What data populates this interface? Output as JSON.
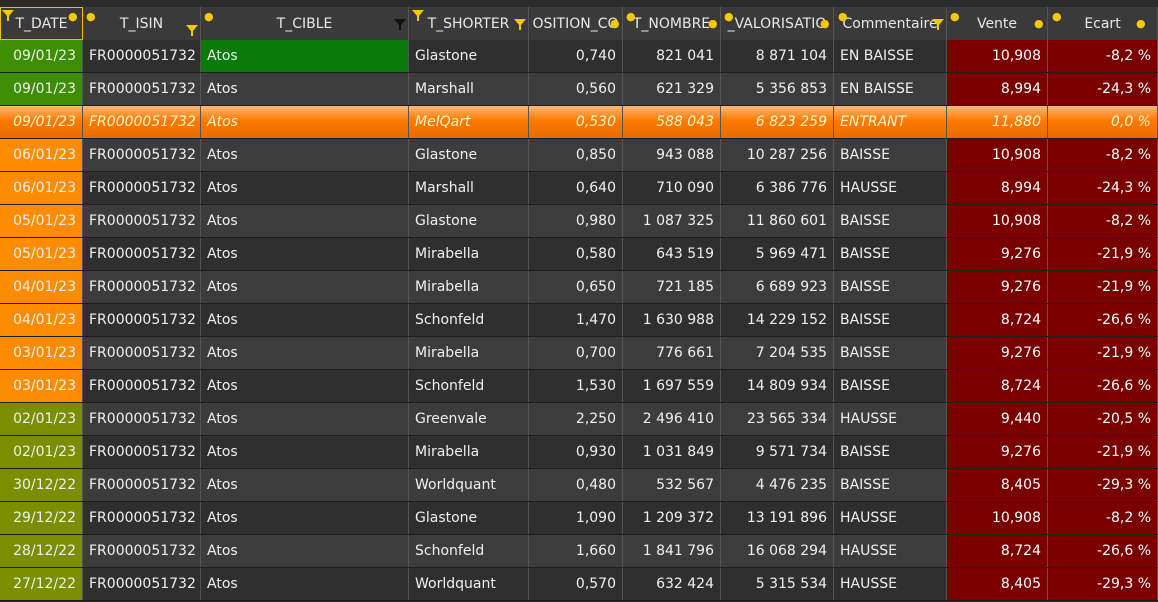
{
  "headers": [
    {
      "label": "T_DATE"
    },
    {
      "label": "T_ISIN"
    },
    {
      "label": "T_CIBLE"
    },
    {
      "label": "T_SHORTER"
    },
    {
      "label": "OSITION_CO"
    },
    {
      "label": "T_NOMBRE"
    },
    {
      "label": "_VALORISATIO"
    },
    {
      "label": "Commentaire"
    },
    {
      "label": "Vente"
    },
    {
      "label": "Ecart"
    }
  ],
  "rows": [
    {
      "date": "09/01/23",
      "isin": "FR0000051732",
      "cible": "Atos",
      "shorter": "Glastone",
      "position": "0,740",
      "nombre": "821 041",
      "valorisation": "8 871 104",
      "commentaire": "EN BAISSE",
      "vente": "10,908",
      "ecart": "-8,2 %",
      "group": "green",
      "cible_hl": true
    },
    {
      "date": "09/01/23",
      "isin": "FR0000051732",
      "cible": "Atos",
      "shorter": "Marshall",
      "position": "0,560",
      "nombre": "621 329",
      "valorisation": "5 356 853",
      "commentaire": "EN BAISSE",
      "vente": "8,994",
      "ecart": "-24,3 %",
      "group": "green"
    },
    {
      "date": "09/01/23",
      "isin": "FR0000051732",
      "cible": "Atos",
      "shorter": "MelQart",
      "position": "0,530",
      "nombre": "588 043",
      "valorisation": "6 823 259",
      "commentaire": "ENTRANT",
      "vente": "11,880",
      "ecart": "0,0 %",
      "group": "orange",
      "active": true
    },
    {
      "date": "06/01/23",
      "isin": "FR0000051732",
      "cible": "Atos",
      "shorter": "Glastone",
      "position": "0,850",
      "nombre": "943 088",
      "valorisation": "10 287 256",
      "commentaire": "BAISSE",
      "vente": "10,908",
      "ecart": "-8,2 %",
      "group": "orange"
    },
    {
      "date": "06/01/23",
      "isin": "FR0000051732",
      "cible": "Atos",
      "shorter": "Marshall",
      "position": "0,640",
      "nombre": "710 090",
      "valorisation": "6 386 776",
      "commentaire": "HAUSSE",
      "vente": "8,994",
      "ecart": "-24,3 %",
      "group": "orange"
    },
    {
      "date": "05/01/23",
      "isin": "FR0000051732",
      "cible": "Atos",
      "shorter": "Glastone",
      "position": "0,980",
      "nombre": "1 087 325",
      "valorisation": "11 860 601",
      "commentaire": "BAISSE",
      "vente": "10,908",
      "ecart": "-8,2 %",
      "group": "orange"
    },
    {
      "date": "05/01/23",
      "isin": "FR0000051732",
      "cible": "Atos",
      "shorter": "Mirabella",
      "position": "0,580",
      "nombre": "643 519",
      "valorisation": "5 969 471",
      "commentaire": "BAISSE",
      "vente": "9,276",
      "ecart": "-21,9 %",
      "group": "orange"
    },
    {
      "date": "04/01/23",
      "isin": "FR0000051732",
      "cible": "Atos",
      "shorter": "Mirabella",
      "position": "0,650",
      "nombre": "721 185",
      "valorisation": "6 689 923",
      "commentaire": "BAISSE",
      "vente": "9,276",
      "ecart": "-21,9 %",
      "group": "orange"
    },
    {
      "date": "04/01/23",
      "isin": "FR0000051732",
      "cible": "Atos",
      "shorter": "Schonfeld",
      "position": "1,470",
      "nombre": "1 630 988",
      "valorisation": "14 229 152",
      "commentaire": "BAISSE",
      "vente": "8,724",
      "ecart": "-26,6 %",
      "group": "orange"
    },
    {
      "date": "03/01/23",
      "isin": "FR0000051732",
      "cible": "Atos",
      "shorter": "Mirabella",
      "position": "0,700",
      "nombre": "776 661",
      "valorisation": "7 204 535",
      "commentaire": "BAISSE",
      "vente": "9,276",
      "ecart": "-21,9 %",
      "group": "orange"
    },
    {
      "date": "03/01/23",
      "isin": "FR0000051732",
      "cible": "Atos",
      "shorter": "Schonfeld",
      "position": "1,530",
      "nombre": "1 697 559",
      "valorisation": "14 809 934",
      "commentaire": "BAISSE",
      "vente": "8,724",
      "ecart": "-26,6 %",
      "group": "orange"
    },
    {
      "date": "02/01/23",
      "isin": "FR0000051732",
      "cible": "Atos",
      "shorter": "Greenvale",
      "position": "2,250",
      "nombre": "2 496 410",
      "valorisation": "23 565 334",
      "commentaire": "HAUSSE",
      "vente": "9,440",
      "ecart": "-20,5 %",
      "group": "olive"
    },
    {
      "date": "02/01/23",
      "isin": "FR0000051732",
      "cible": "Atos",
      "shorter": "Mirabella",
      "position": "0,930",
      "nombre": "1 031 849",
      "valorisation": "9 571 734",
      "commentaire": "BAISSE",
      "vente": "9,276",
      "ecart": "-21,9 %",
      "group": "olive"
    },
    {
      "date": "30/12/22",
      "isin": "FR0000051732",
      "cible": "Atos",
      "shorter": "Worldquant",
      "position": "0,480",
      "nombre": "532 567",
      "valorisation": "4 476 235",
      "commentaire": "BAISSE",
      "vente": "8,405",
      "ecart": "-29,3 %",
      "group": "olive"
    },
    {
      "date": "29/12/22",
      "isin": "FR0000051732",
      "cible": "Atos",
      "shorter": "Glastone",
      "position": "1,090",
      "nombre": "1 209 372",
      "valorisation": "13 191 896",
      "commentaire": "HAUSSE",
      "vente": "10,908",
      "ecart": "-8,2 %",
      "group": "olive"
    },
    {
      "date": "28/12/22",
      "isin": "FR0000051732",
      "cible": "Atos",
      "shorter": "Schonfeld",
      "position": "1,660",
      "nombre": "1 841 796",
      "valorisation": "16 068 294",
      "commentaire": "HAUSSE",
      "vente": "8,724",
      "ecart": "-26,6 %",
      "group": "olive"
    },
    {
      "date": "27/12/22",
      "isin": "FR0000051732",
      "cible": "Atos",
      "shorter": "Worldquant",
      "position": "0,570",
      "nombre": "632 424",
      "valorisation": "5 315 534",
      "commentaire": "HAUSSE",
      "vente": "8,405",
      "ecart": "-29,3 %",
      "group": "olive"
    }
  ],
  "colors": {
    "header_bg": "#3a3a3a",
    "row_even": "#2f2f2f",
    "row_odd": "#3c3c3c",
    "vente_ecart_bg": "#7a0000",
    "date_green": "#3c8f00",
    "date_orange": "#ff8c00",
    "date_olive": "#7a8f00",
    "selected_row": "#ff7a00",
    "filter_icon": "#f5c800"
  }
}
